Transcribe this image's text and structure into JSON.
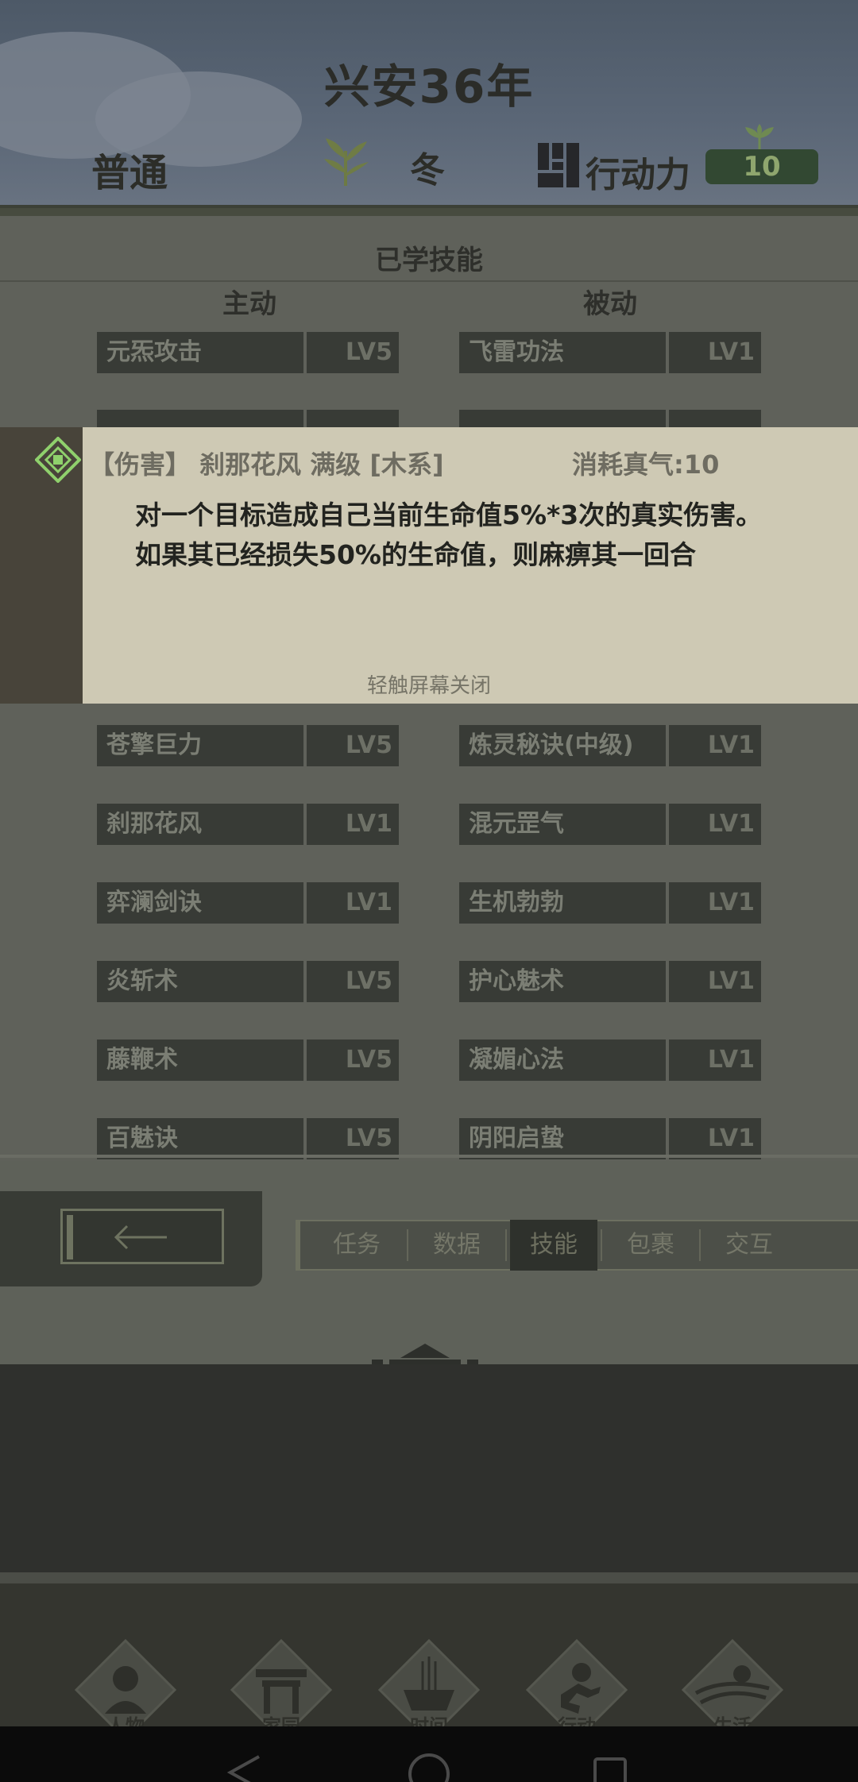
{
  "header": {
    "year": "兴安36年",
    "mode": "普通",
    "season": "冬",
    "ap_label": "行动力",
    "ap_value": "10"
  },
  "skills": {
    "title": "已学技能",
    "active_heading": "主动",
    "passive_heading": "被动",
    "active": [
      {
        "name": "元炁攻击",
        "level": "LV5"
      },
      {
        "name": "苍擎巨力",
        "level": "LV5"
      },
      {
        "name": "刹那花风",
        "level": "LV1"
      },
      {
        "name": "弈澜剑诀",
        "level": "LV1"
      },
      {
        "name": "炎斩术",
        "level": "LV5"
      },
      {
        "name": "藤鞭术",
        "level": "LV5"
      },
      {
        "name": "百魅诀",
        "level": "LV5"
      }
    ],
    "passive": [
      {
        "name": "飞雷功法",
        "level": "LV1"
      },
      {
        "name": "炼灵秘诀(中级)",
        "level": "LV1"
      },
      {
        "name": "混元罡气",
        "level": "LV1"
      },
      {
        "name": "生机勃勃",
        "level": "LV1"
      },
      {
        "name": "护心魅术",
        "level": "LV1"
      },
      {
        "name": "凝媚心法",
        "level": "LV1"
      },
      {
        "name": "阴阳启蛰",
        "level": "LV1"
      }
    ]
  },
  "tooltip": {
    "header": "【伤害】 刹那花风 满级 [木系]",
    "cost": "消耗真气:10",
    "line1": "对一个目标造成自己当前生命值5%*3次的真实伤害。",
    "line2": "如果其已经损失50%的生命值，则麻痹其一回合",
    "hint": "轻触屏幕关闭"
  },
  "tabs": [
    "任务",
    "数据",
    "技能",
    "包裹",
    "交互"
  ],
  "active_tab": "技能",
  "nav": [
    "人物",
    "家园",
    "时间",
    "行动",
    "生活"
  ],
  "icons": {
    "back": "left-arrow-icon",
    "tooltip_marker": "diamond-icon",
    "season": "wheat-icon",
    "action_points": "grid-icon"
  }
}
